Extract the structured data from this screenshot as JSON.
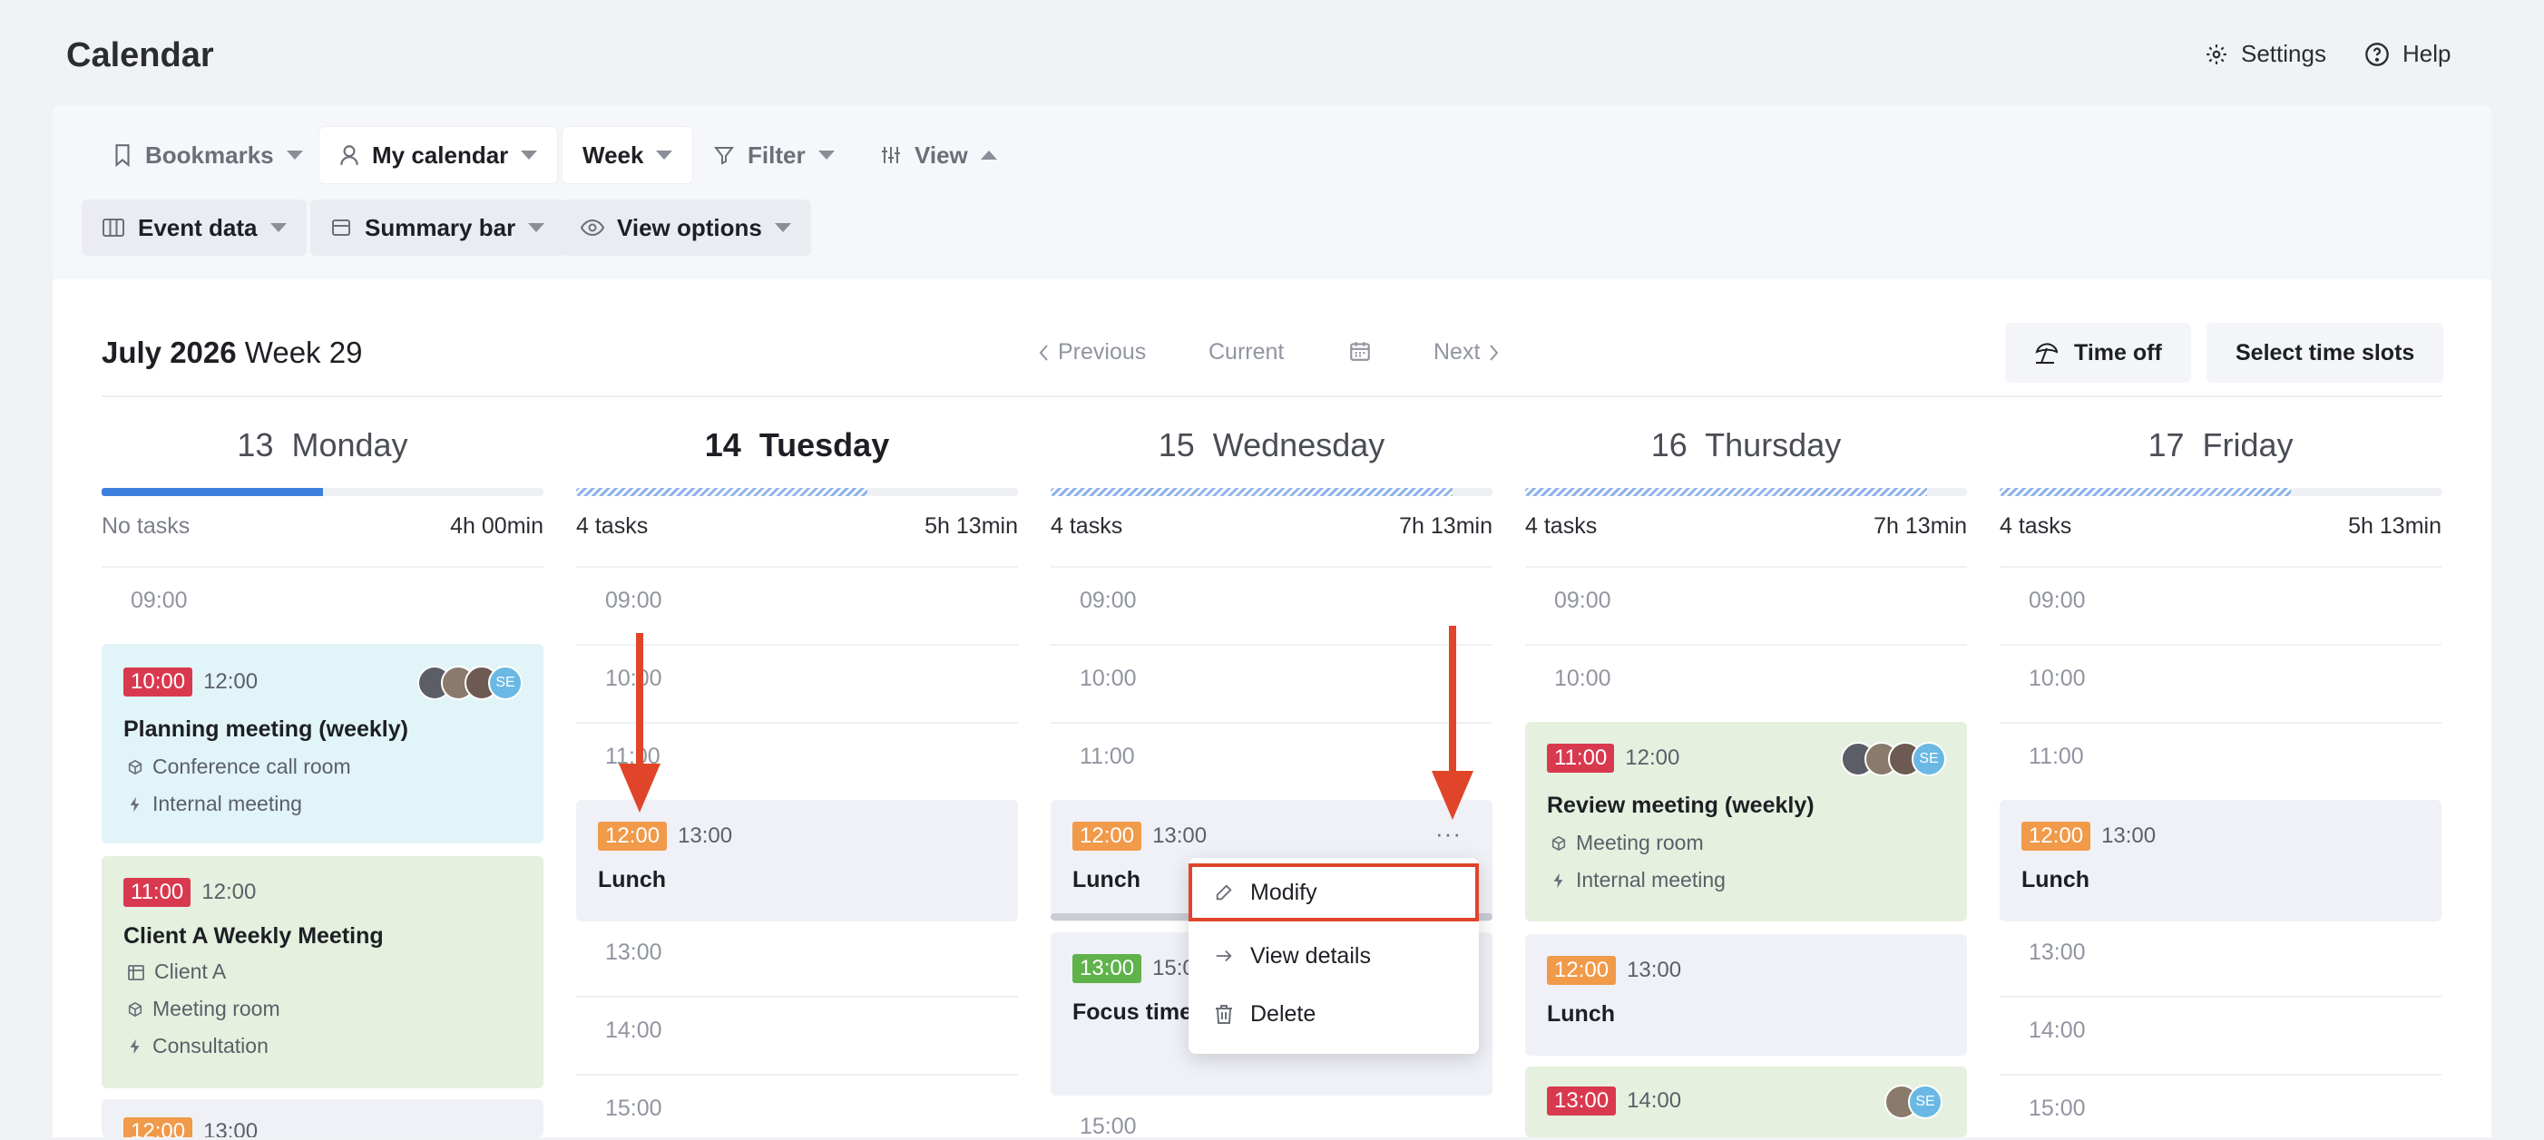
{
  "header": {
    "title": "Calendar",
    "settings_label": "Settings",
    "help_label": "Help"
  },
  "toolbar": {
    "bookmarks": "Bookmarks",
    "my_calendar": "My calendar",
    "week": "Week",
    "filter": "Filter",
    "view": "View",
    "event_data": "Event data",
    "summary_bar": "Summary bar",
    "view_options": "View options"
  },
  "period": {
    "month_year": "July 2026",
    "week": "Week 29"
  },
  "nav": {
    "previous": "Previous",
    "current": "Current",
    "next": "Next"
  },
  "actions": {
    "time_off": "Time off",
    "select_slots": "Select time slots"
  },
  "days": [
    {
      "num": "13",
      "name": "Monday",
      "tasks": "No tasks",
      "duration": "4h 00min",
      "progress": 0.5,
      "style": "solid"
    },
    {
      "num": "14",
      "name": "Tuesday",
      "tasks": "4 tasks",
      "duration": "5h 13min",
      "progress": 0.66,
      "style": "hatched",
      "today": true
    },
    {
      "num": "15",
      "name": "Wednesday",
      "tasks": "4 tasks",
      "duration": "7h 13min",
      "progress": 0.91,
      "style": "hatched"
    },
    {
      "num": "16",
      "name": "Thursday",
      "tasks": "4 tasks",
      "duration": "7h 13min",
      "progress": 0.91,
      "style": "hatched"
    },
    {
      "num": "17",
      "name": "Friday",
      "tasks": "4 tasks",
      "duration": "5h 13min",
      "progress": 0.66,
      "style": "hatched"
    }
  ],
  "times": [
    "09:00",
    "10:00",
    "11:00",
    "12:00",
    "13:00",
    "14:00",
    "15:00"
  ],
  "events": {
    "mon_planning": {
      "start": "10:00",
      "end": "12:00",
      "title": "Planning meeting (weekly)",
      "location": "Conference call room",
      "type": "Internal meeting",
      "avatar_initials": "SE"
    },
    "mon_client": {
      "start": "11:00",
      "end": "12:00",
      "title": "Client A Weekly Meeting",
      "client": "Client A",
      "location": "Meeting room",
      "type": "Consultation"
    },
    "mon_partial": {
      "start": "12:00",
      "end": "13:00"
    },
    "tue_lunch": {
      "start": "12:00",
      "end": "13:00",
      "title": "Lunch"
    },
    "wed_lunch": {
      "start": "12:00",
      "end": "13:00",
      "title": "Lunch"
    },
    "wed_focus": {
      "start": "13:00",
      "end": "15:00",
      "title": "Focus time"
    },
    "thu_review": {
      "start": "11:00",
      "end": "12:00",
      "title": "Review meeting (weekly)",
      "location": "Meeting room",
      "type": "Internal meeting",
      "avatar_initials": "SE"
    },
    "thu_lunch": {
      "start": "12:00",
      "end": "13:00",
      "title": "Lunch"
    },
    "thu_next": {
      "start": "13:00",
      "end": "14:00",
      "avatar_initials": "SE"
    },
    "fri_lunch": {
      "start": "12:00",
      "end": "13:00",
      "title": "Lunch"
    }
  },
  "context_menu": {
    "modify": "Modify",
    "view_details": "View details",
    "delete": "Delete"
  },
  "colors": {
    "accent_red": "#d9394f",
    "accent_orange": "#f09a4a",
    "accent_green": "#5fb34a",
    "progress_blue": "#3d7fdc",
    "annotation": "#e0452a"
  }
}
